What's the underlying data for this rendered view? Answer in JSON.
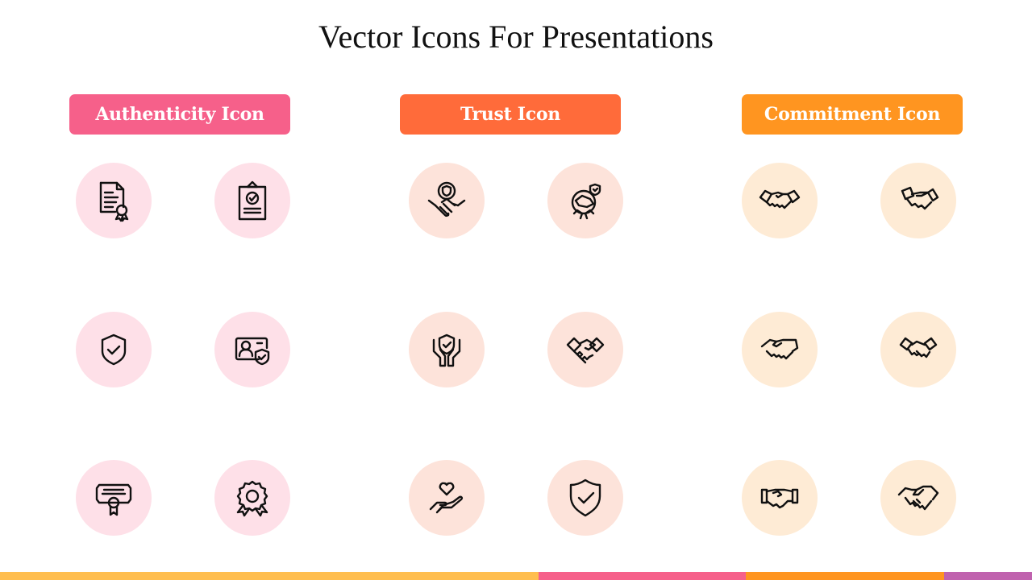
{
  "title": "Vector Icons For Presentations",
  "sections": [
    {
      "label": "Authenticity Icon",
      "badge_color": "#F6608A",
      "circle_color": "#FEE0E8",
      "icons": [
        "document-certificate-icon",
        "clipboard-check-icon",
        "shield-check-icon",
        "id-card-shield-icon",
        "certificate-ribbon-icon",
        "award-badge-icon"
      ]
    },
    {
      "label": "Trust Icon",
      "badge_color": "#FF6B3A",
      "circle_color": "#FDE3DA",
      "icons": [
        "handshake-shield-icon",
        "handclasp-shield-icon",
        "hands-shield-icon",
        "handshake-icon",
        "hand-heart-icon",
        "shield-check-icon"
      ]
    },
    {
      "label": "Commitment Icon",
      "badge_color": "#FF9520",
      "circle_color": "#FEEBD5",
      "icons": [
        "handshake-icon",
        "handshake-outline-icon",
        "handshake-icon",
        "handshake-icon",
        "handshake-cuffs-icon",
        "handshake-icon"
      ]
    }
  ],
  "footer_colors": [
    "#FFBE4F",
    "#F6608A",
    "#FF9520",
    "#C062AE"
  ]
}
